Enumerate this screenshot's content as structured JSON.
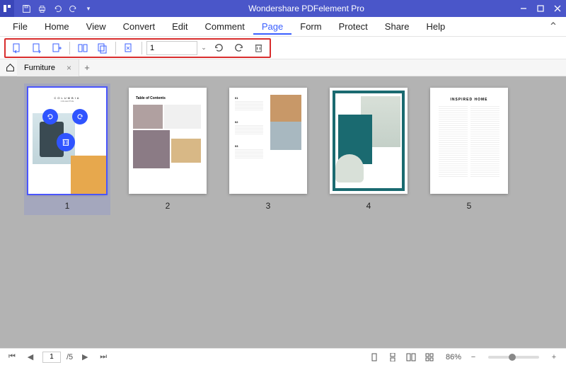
{
  "titlebar": {
    "app_title": "Wondershare PDFelement Pro",
    "qat": {
      "save": "save-icon",
      "print": "print-icon",
      "undo": "undo-icon",
      "redo": "redo-icon",
      "more": "more"
    }
  },
  "menu": {
    "items": [
      "File",
      "Home",
      "View",
      "Convert",
      "Edit",
      "Comment",
      "Page",
      "Form",
      "Protect",
      "Share",
      "Help"
    ],
    "active_index": 6
  },
  "toolbar": {
    "page_input_value": "1"
  },
  "tabs": {
    "document_name": "Furniture"
  },
  "pages": {
    "count": 5,
    "selected": 1,
    "labels": [
      "1",
      "2",
      "3",
      "4",
      "5"
    ],
    "p1": {
      "title": "COLUMBIA",
      "subtitle": "COLLECTIVE",
      "overlay_icons": [
        "rotate-left-icon",
        "rotate-right-icon",
        "delete-icon"
      ]
    },
    "p2": {
      "title": "Table of Contents"
    },
    "p3": {
      "labels": [
        "01",
        "02",
        "03"
      ]
    },
    "p5": {
      "title": "INSPIRED HOME"
    }
  },
  "statusbar": {
    "page_current": "1",
    "page_total": "/5",
    "zoom_value": "86%"
  }
}
